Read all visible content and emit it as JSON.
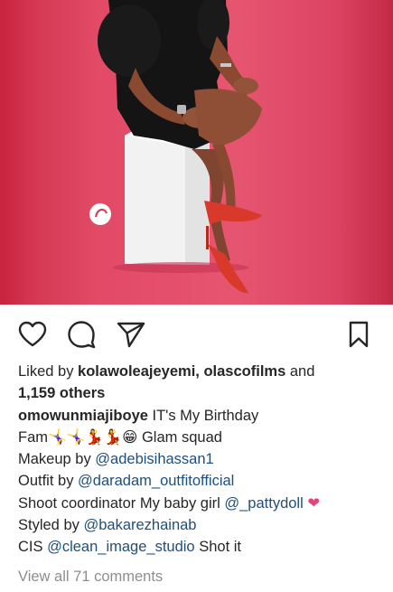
{
  "post": {
    "image_alt": "Woman in black dress sitting on white box wearing red heels",
    "liked_prefix": "Liked by ",
    "liker_1": "kolawoleajeyemi",
    "comma": ", ",
    "liker_2": "olascofilms",
    "and": " and",
    "others": "1,159 others",
    "author": "omowunmiajiboye",
    "caption_1": " IT's My Birthday",
    "caption_2": "Fam🤸‍♀️🤸‍♀️💃💃😁 Glam squad",
    "makeup_prefix": "Makeup by ",
    "makeup_handle": "@adebisihassan1",
    "outfit_prefix": "Outfit by ",
    "outfit_handle": "@daradam_outfitofficial",
    "shoot_prefix": "Shoot coordinator My baby girl ",
    "shoot_handle": "@_pattydoll",
    "heart_emoji": "❤",
    "styled_prefix": "Styled by ",
    "styled_handle": "@bakarezhainab",
    "cis_prefix": "CIS ",
    "cis_handle": "@clean_image_studio",
    "cis_suffix": " Shot it",
    "view_comments": "View all 71 comments"
  },
  "icons": {
    "like": "heart-outline-icon",
    "comment": "speech-bubble-icon",
    "share": "paper-plane-icon",
    "save": "bookmark-icon"
  },
  "colors": {
    "link": "#1f4f7a",
    "text": "#262626",
    "muted": "#8e8e8e",
    "background_pink": "#e4506c",
    "heart_pink": "#e2457a"
  }
}
